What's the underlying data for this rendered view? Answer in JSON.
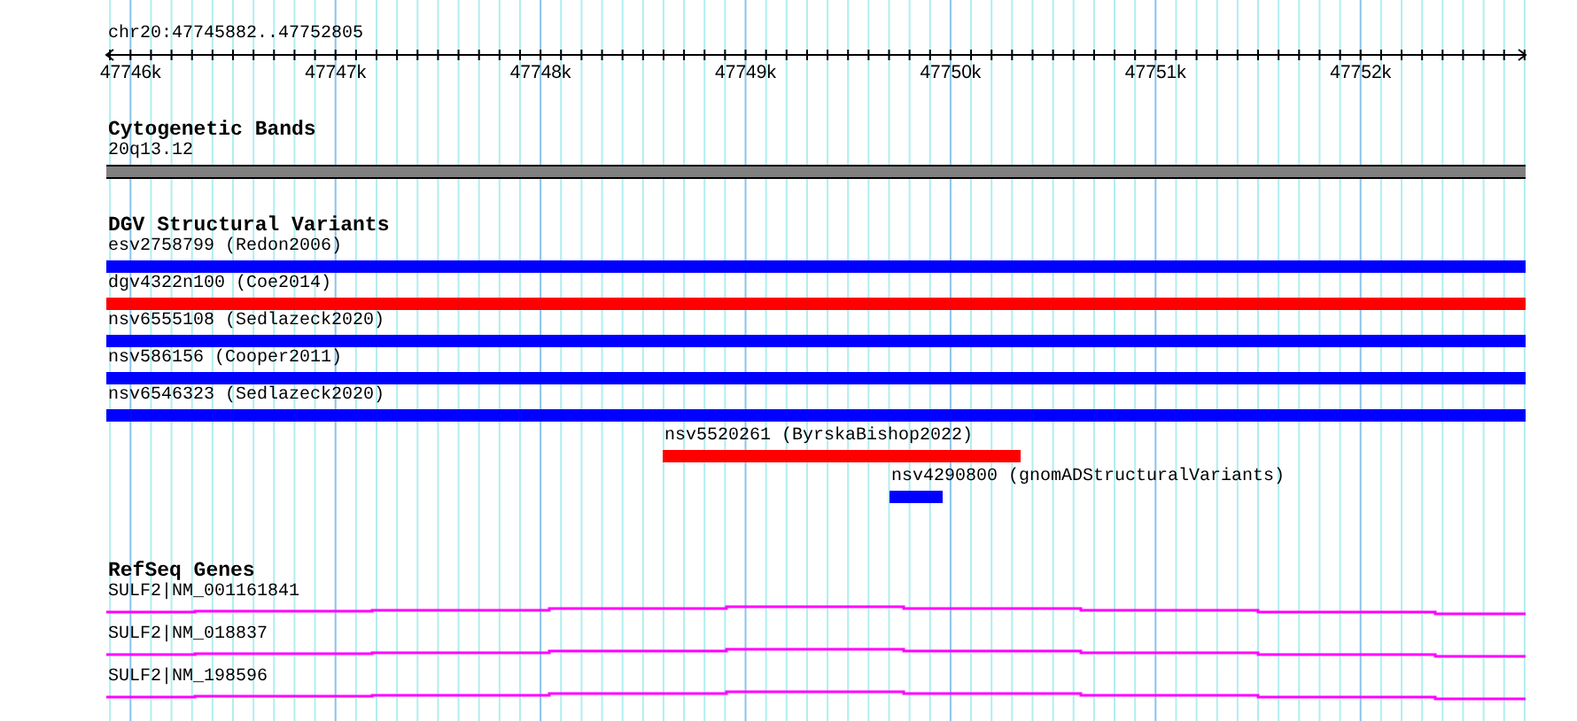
{
  "ruler": {
    "location": "chr20:47745882..47752805",
    "ticks": [
      "47746k",
      "47747k",
      "47748k",
      "47749k",
      "47750k",
      "47751k",
      "47752k"
    ]
  },
  "tracks": [
    {
      "kind": "bands",
      "title": "Cytogenetic Bands",
      "features": [
        {
          "label": "20q13.12"
        }
      ]
    },
    {
      "kind": "variants",
      "title": "DGV Structural Variants",
      "features": [
        {
          "label": "esv2758799 (Redon2006)",
          "color": "#0000ff"
        },
        {
          "label": "dgv4322n100 (Coe2014)",
          "color": "#ff0000"
        },
        {
          "label": "nsv6555108 (Sedlazeck2020)",
          "color": "#0000ff"
        },
        {
          "label": "nsv586156 (Cooper2011)",
          "color": "#0000ff"
        },
        {
          "label": "nsv6546323 (Sedlazeck2020)",
          "color": "#0000ff"
        },
        {
          "label": "nsv5520261 (ByrskaBishop2022)",
          "color": "#ff0000"
        },
        {
          "label": "nsv4290800 (gnomADStructuralVariants)",
          "color": "#0000ff"
        }
      ]
    },
    {
      "kind": "genes",
      "title": "RefSeq Genes",
      "features": [
        {
          "label": "SULF2|NM_001161841"
        },
        {
          "label": "SULF2|NM_018837"
        },
        {
          "label": "SULF2|NM_198596"
        }
      ]
    }
  ]
}
